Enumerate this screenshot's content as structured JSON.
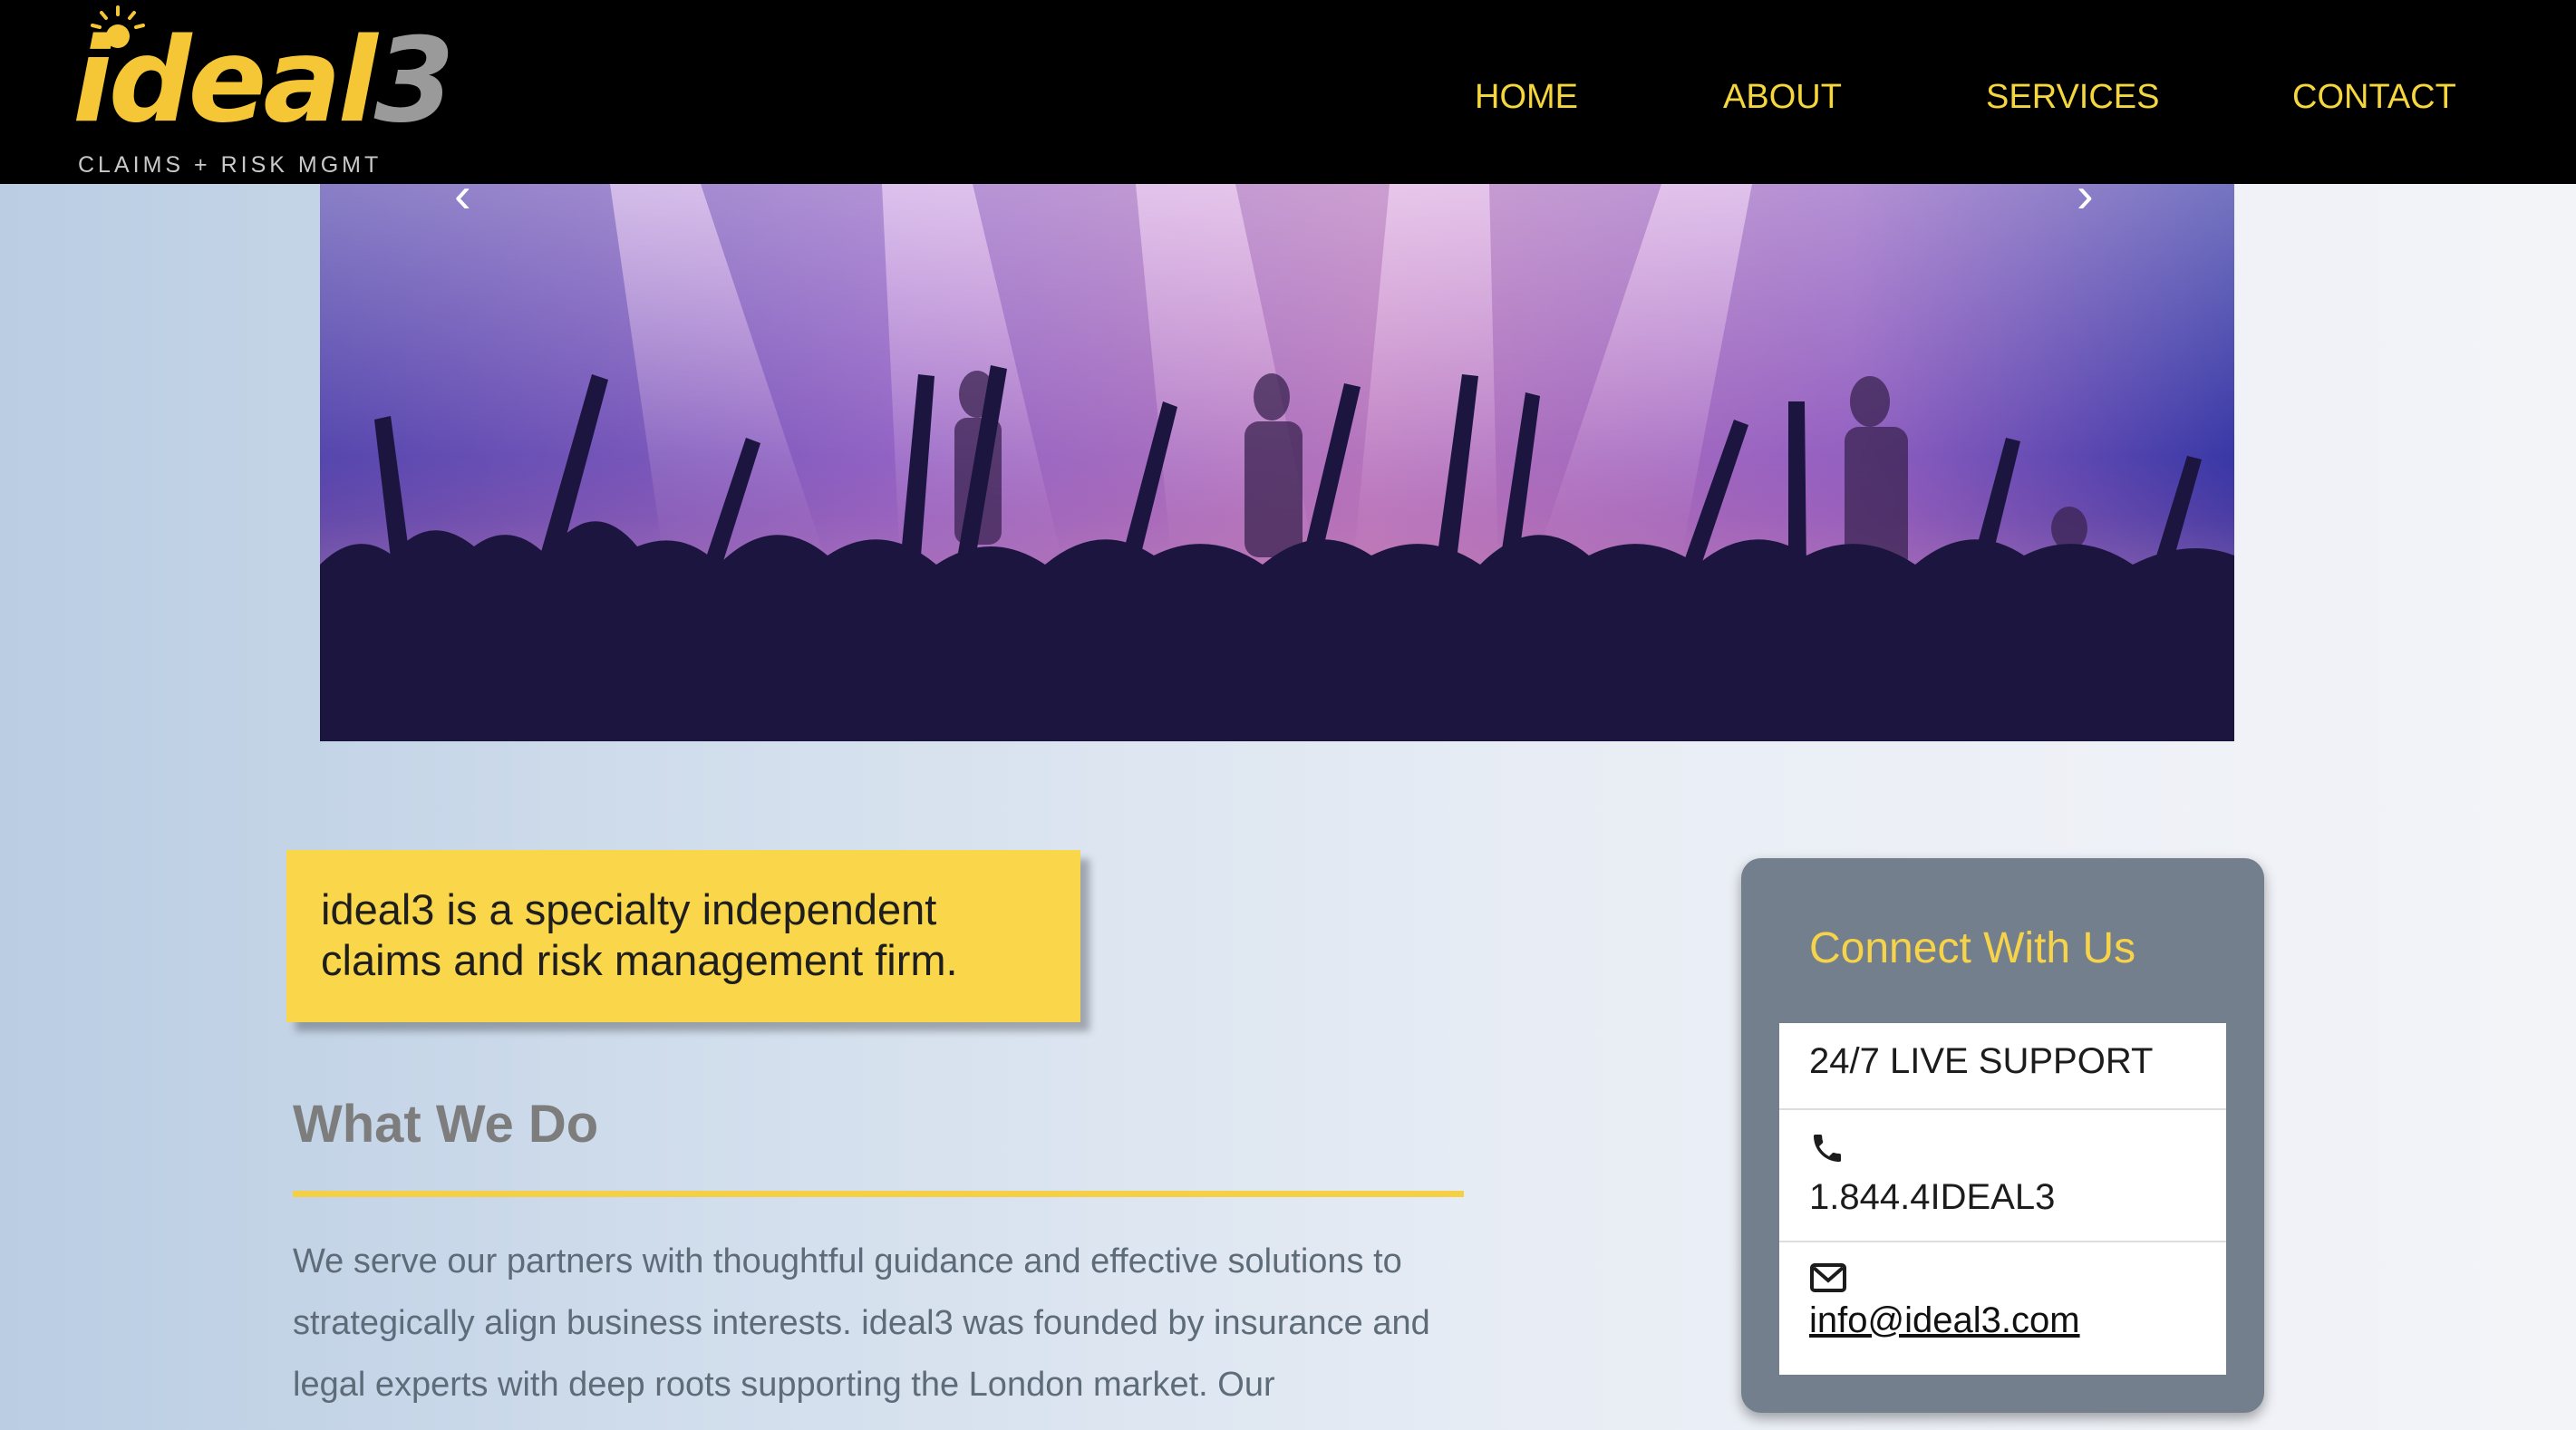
{
  "brand": {
    "logo_text_main": "ideal",
    "logo_text_num": "3",
    "logo_tagline": "CLAIMS + RISK MGMT"
  },
  "nav": {
    "items": [
      {
        "label": "HOME"
      },
      {
        "label": "ABOUT"
      },
      {
        "label": "SERVICES"
      },
      {
        "label": "CONTACT"
      }
    ]
  },
  "hero": {
    "prev_arrow": "‹",
    "next_arrow": "›"
  },
  "tagline": {
    "text": "ideal3 is a specialty independent claims and risk management firm."
  },
  "what_we_do": {
    "title": "What We Do",
    "body": "We serve our partners with thoughtful guidance and effective solutions to strategically align business interests. ideal3 was founded by insurance and legal experts with deep roots supporting the London market. Our"
  },
  "connect": {
    "title": "Connect With Us",
    "support_label": "24/7 LIVE SUPPORT",
    "phone": "1.844.4IDEAL3",
    "email": "info@ideal3.com",
    "phone_icon": "phone-icon",
    "email_icon": "envelope-icon"
  },
  "colors": {
    "header_bg": "#000000",
    "nav_text": "#f5d63c",
    "accent_yellow": "#fad64a",
    "card_bg": "#737f8c",
    "connect_title": "#f7d34a"
  }
}
